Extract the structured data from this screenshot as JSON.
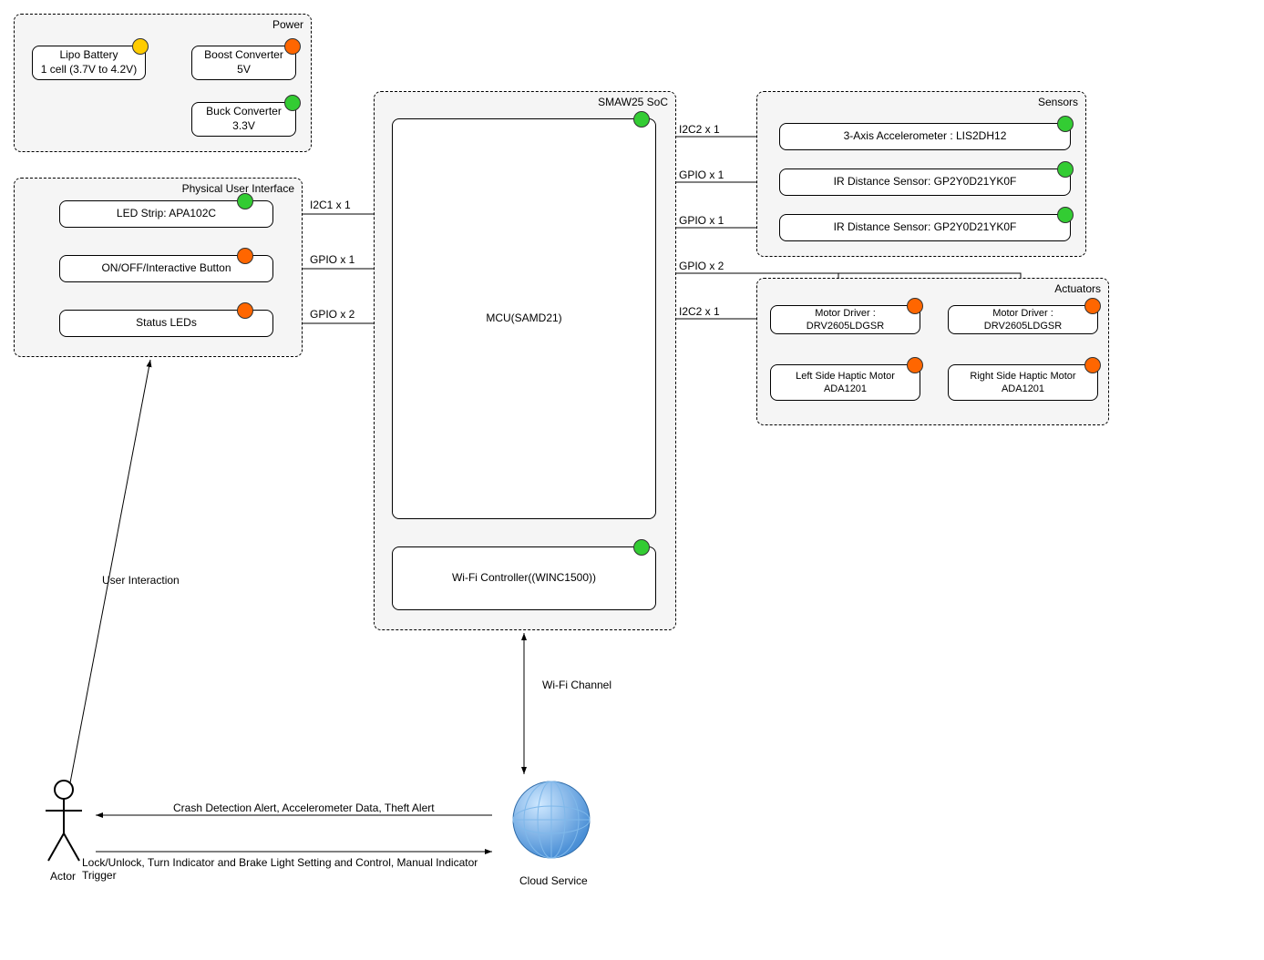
{
  "groups": {
    "power": "Power",
    "pui": "Physical User Interface",
    "soc": "SMAW25 SoC",
    "sensors": "Sensors",
    "actuators": "Actuators"
  },
  "boxes": {
    "lipo": {
      "l1": "Lipo Battery",
      "l2": "1 cell (3.7V to 4.2V)"
    },
    "boost": {
      "l1": "Boost Converter",
      "l2": "5V"
    },
    "buck": {
      "l1": "Buck Converter",
      "l2": "3.3V"
    },
    "led": "LED Strip: APA102C",
    "button": "ON/OFF/Interactive Button",
    "status": "Status LEDs",
    "mcu": "MCU(SAMD21)",
    "wifi": "Wi-Fi Controller((WINC1500))",
    "accel": "3-Axis Accelerometer : LIS2DH12",
    "ir1": "IR Distance Sensor: GP2Y0D21YK0F",
    "ir2": "IR Distance Sensor: GP2Y0D21YK0F",
    "md1": "Motor Driver : DRV2605LDGSR",
    "md2": "Motor Driver : DRV2605LDGSR",
    "lm": {
      "l1": "Left Side Haptic Motor",
      "l2": "ADA1201"
    },
    "rm": {
      "l1": "Right Side Haptic Motor",
      "l2": "ADA1201"
    }
  },
  "labels": {
    "i2c1": "I2C1 x 1",
    "gpio1a": "GPIO x 1",
    "gpio2a": "GPIO x 2",
    "i2c2a": "I2C2 x 1",
    "gpio1b": "GPIO x 1",
    "gpio1c": "GPIO x 1",
    "gpio2b": "GPIO x 2",
    "i2c2b": "I2C2 x 1",
    "wifich": "Wi-Fi Channel",
    "userint": "User Interaction",
    "up": "Crash Detection Alert, Accelerometer Data, Theft Alert",
    "down": "Lock/Unlock, Turn Indicator and Brake Light Setting and Control, Manual Indicator Trigger",
    "actor": "Actor",
    "cloud": "Cloud Service"
  }
}
